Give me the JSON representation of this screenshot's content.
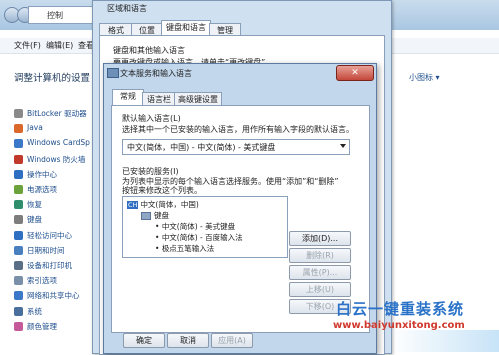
{
  "control_panel": {
    "address": "控制",
    "menu": [
      "文件(F)",
      "编辑(E)",
      "查看(V)"
    ],
    "title": "调整计算机的设置",
    "view_link": "小图标",
    "items": [
      {
        "label": "BitLocker 驱动器",
        "color": "#8a8a8a"
      },
      {
        "label": "Java",
        "color": "#d9682a"
      },
      {
        "label": "Windows CardSp",
        "color": "#3c78c8"
      },
      {
        "label": "Windows 防火墙",
        "color": "#c0392b"
      },
      {
        "label": "操作中心",
        "color": "#2f6fc2"
      },
      {
        "label": "电源选项",
        "color": "#6ba33a"
      },
      {
        "label": "恢复",
        "color": "#2f8f6c"
      },
      {
        "label": "键盘",
        "color": "#7d7d7d"
      },
      {
        "label": "轻松访问中心",
        "color": "#2f6fc2"
      },
      {
        "label": "日期和时间",
        "color": "#4a7fbf"
      },
      {
        "label": "设备和打印机",
        "color": "#5a6f86"
      },
      {
        "label": "索引选项",
        "color": "#7a8fa8"
      },
      {
        "label": "网络和共享中心",
        "color": "#3c78c8"
      },
      {
        "label": "系统",
        "color": "#4a6f9c"
      },
      {
        "label": "颜色管理",
        "color": "#c45a9a"
      }
    ]
  },
  "region_dialog": {
    "title": "区域和语言",
    "tabs": [
      "格式",
      "位置",
      "键盘和语言",
      "管理"
    ],
    "active_tab": 2,
    "group_label": "键盘和其他输入语言",
    "group_text": "要更改键盘或输入语言，请单击“更改键盘”。"
  },
  "text_services": {
    "title": "文本服务和输入语言",
    "close_glyph": "✕",
    "tabs": [
      "常规",
      "语言栏",
      "高级键设置"
    ],
    "active_tab": 0,
    "default_lang_heading": "默认输入语言(L)",
    "default_lang_desc": "选择其中一个已安装的输入语言，用作所有输入字段的默认语言。",
    "default_lang_value": "中文(简体，中国) - 中文(简体) - 美式键盘",
    "installed_heading": "已安装的服务(I)",
    "installed_desc1": "为列表中显示的每个输入语言选择服务。使用“添加”和“删除”",
    "installed_desc2": "按钮来修改这个列表。",
    "tree": {
      "lang_badge": "CH",
      "lang": "中文(简体，中国)",
      "keyboard_label": "键盘",
      "entries": [
        "中文(简体) - 美式键盘",
        "中文(简体) - 百度输入法",
        "极点五笔输入法"
      ]
    },
    "buttons": {
      "add": "添加(D)...",
      "remove": "删除(R)",
      "properties": "属性(P)...",
      "move_up": "上移(U)",
      "move_down": "下移(O)"
    },
    "footer": {
      "ok": "确定",
      "cancel": "取消",
      "apply": "应用(A)"
    }
  },
  "watermark": {
    "line1": "白云一键重装系统",
    "line2": "www.baiyunxitong.com"
  }
}
